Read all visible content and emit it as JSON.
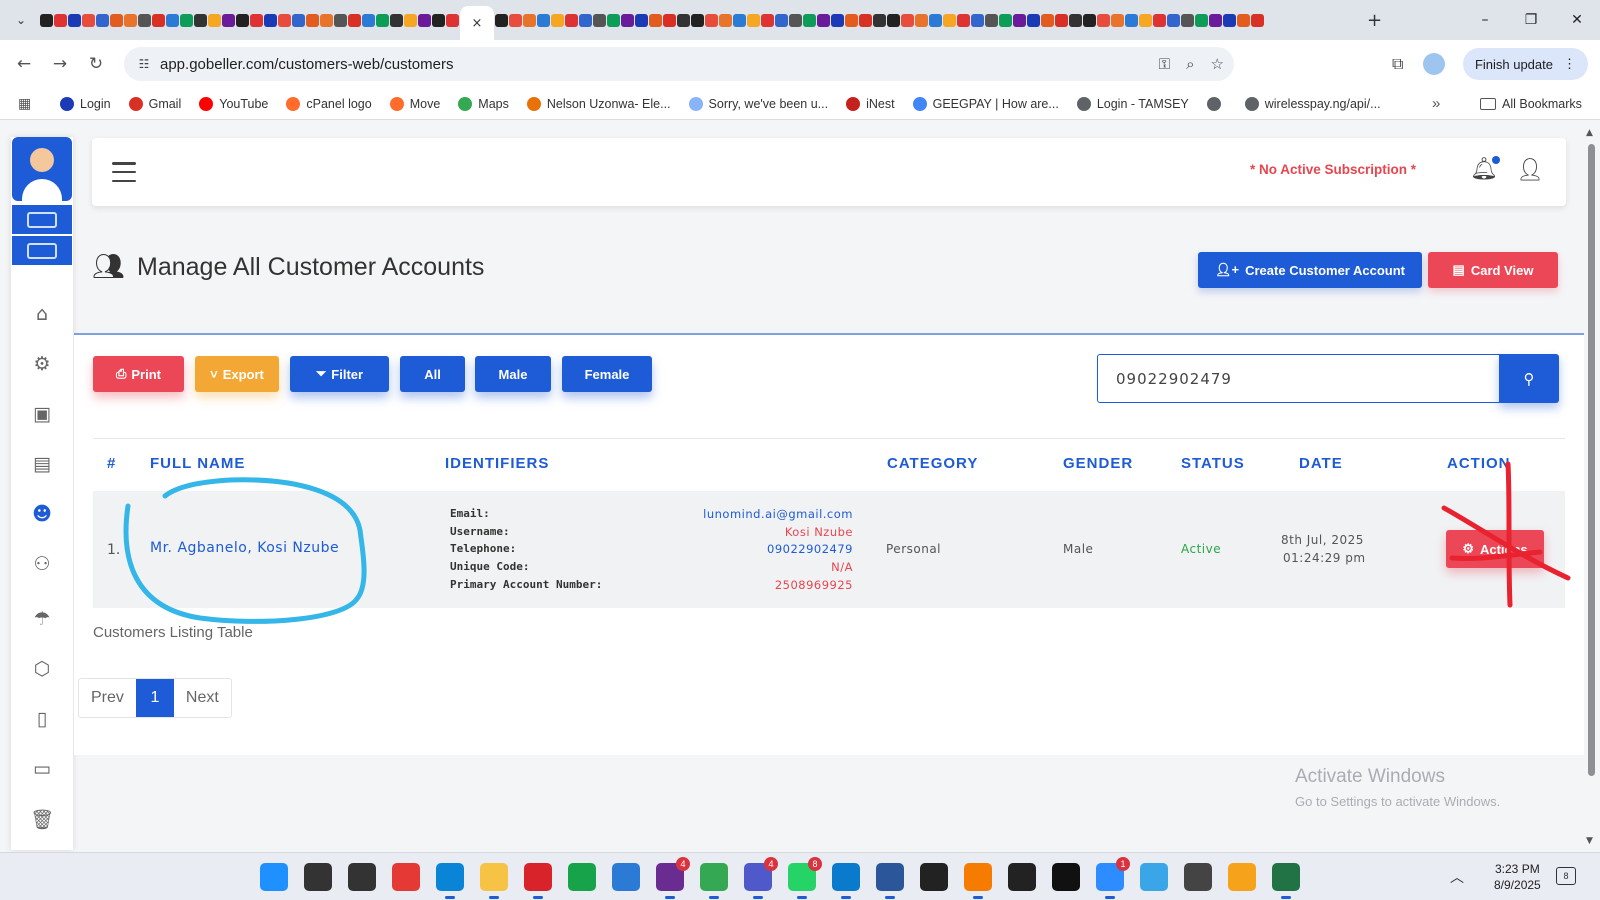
{
  "browser": {
    "active_tab_close": "×",
    "new_tab": "+",
    "tab_dropdown": "⌄",
    "window_controls": {
      "minimize": "–",
      "restore": "❐",
      "close": "✕"
    },
    "url": "app.gobeller.com/customers-web/customers",
    "finish_update": "Finish update",
    "bookmarks": [
      {
        "label": "Login",
        "color": "#1a3bb5"
      },
      {
        "label": "Gmail",
        "color": "#d93025"
      },
      {
        "label": "YouTube",
        "color": "#ff0000"
      },
      {
        "label": "cPanel logo",
        "color": "#ff6c2c"
      },
      {
        "label": "Move",
        "color": "#ff6c2c"
      },
      {
        "label": "Maps",
        "color": "#34a853"
      },
      {
        "label": "Nelson Uzonwa- Ele...",
        "color": "#e8710a"
      },
      {
        "label": "Sorry, we've been u...",
        "color": "#8ab4f8"
      },
      {
        "label": "iNest",
        "color": "#c5221f"
      },
      {
        "label": "GEEGPAY | How are...",
        "color": "#4285f4"
      },
      {
        "label": "Login - TAMSEY",
        "color": "#5f6368"
      },
      {
        "label": "",
        "color": "#5f6368"
      },
      {
        "label": "wirelesspay.ng/api/...",
        "color": "#5f6368"
      }
    ],
    "bookmarks_more": "»",
    "all_bookmarks": "All Bookmarks"
  },
  "topbar": {
    "subscription_notice": "* No Active Subscription *"
  },
  "page": {
    "title": "Manage All Customer Accounts",
    "create_button": "Create Customer Account",
    "card_view_button": "Card View"
  },
  "toolbar": {
    "print": "Print",
    "export": "Export",
    "filter": "Filter",
    "all": "All",
    "male": "Male",
    "female": "Female"
  },
  "search": {
    "value": "09022902479"
  },
  "table": {
    "headers": {
      "index": "#",
      "full_name": "FULL NAME",
      "identifiers": "IDENTIFIERS",
      "category": "CATEGORY",
      "gender": "GENDER",
      "status": "STATUS",
      "date": "DATE",
      "action": "ACTION"
    },
    "rows": [
      {
        "index": "1.",
        "full_name": "Mr. Agbanelo, Kosi Nzube",
        "identifiers": [
          {
            "label": "Email:",
            "value": "lunomind.ai@gmail.com",
            "color": "#1e5bd6"
          },
          {
            "label": "Username:",
            "value": "Kosi Nzube",
            "color": "#e8454f"
          },
          {
            "label": "Telephone:",
            "value": "09022902479",
            "color": "#1e5bd6"
          },
          {
            "label": "Unique Code:",
            "value": "N/A",
            "color": "#e8454f"
          },
          {
            "label": "Primary Account Number:",
            "value": "2508969925",
            "color": "#e8454f"
          }
        ],
        "category": "Personal",
        "gender": "Male",
        "status": "Active",
        "date_line1": "8th Jul, 2025",
        "date_line2": "01:24:29 pm",
        "action": "Actions"
      }
    ],
    "caption": "Customers Listing Table"
  },
  "pagination": {
    "prev": "Prev",
    "current": "1",
    "next": "Next"
  },
  "watermark": {
    "line1": "Activate Windows",
    "line2": "Go to Settings to activate Windows."
  },
  "taskbar": {
    "time": "3:23 PM",
    "date": "8/9/2025",
    "notification_count": "8",
    "badges": {
      "slack": "4",
      "teams": "4",
      "whatsapp": "8",
      "zoom": "1"
    }
  },
  "colors": {
    "primary": "#1e5bd6",
    "danger": "#ec4756",
    "warning": "#f3a835",
    "success": "#28a745",
    "annotation_circle": "#35b6e8",
    "annotation_mark": "#e8232f"
  }
}
